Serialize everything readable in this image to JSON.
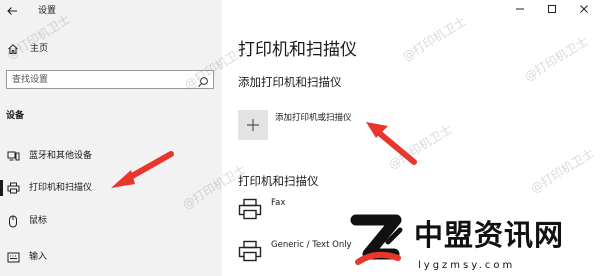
{
  "window": {
    "title": "设置"
  },
  "sidebar": {
    "home_label": "主页",
    "search_placeholder": "查找设置",
    "section_label": "设备",
    "items": [
      {
        "label": "蓝牙和其他设备",
        "icon": "devices-icon"
      },
      {
        "label": "打印机和扫描仪",
        "icon": "printer-icon",
        "active": true
      },
      {
        "label": "鼠标",
        "icon": "mouse-icon"
      },
      {
        "label": "输入",
        "icon": "keyboard-icon"
      }
    ]
  },
  "main": {
    "page_title": "打印机和扫描仪",
    "add_heading": "添加打印机和扫描仪",
    "add_button_label": "添加打印机或扫描仪",
    "printers_heading": "打印机和扫描仪",
    "printers": [
      {
        "name": "Fax",
        "icon": "printer-icon"
      },
      {
        "name": "Generic / Text Only",
        "icon": "printer-icon"
      }
    ]
  },
  "watermark": "@打印机卫士",
  "brand": {
    "name": "中盟资讯网",
    "url": "lygzmsy.com"
  },
  "colors": {
    "sidebar_bg": "#f2f2f2",
    "tile_bg": "#e3e3e3",
    "arrow": "#e8362d"
  }
}
